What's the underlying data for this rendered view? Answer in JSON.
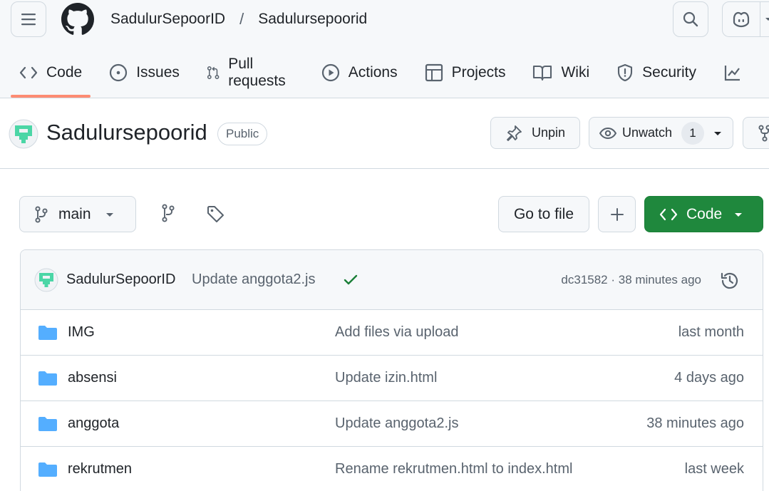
{
  "header": {
    "owner": "SadulurSepoorID",
    "separator": "/",
    "repo": "Sadulursepoorid"
  },
  "tabs": [
    {
      "label": "Code",
      "icon": "code-icon",
      "selected": true
    },
    {
      "label": "Issues",
      "icon": "issue-icon",
      "selected": false
    },
    {
      "label": "Pull requests",
      "icon": "pull-request-icon",
      "selected": false
    },
    {
      "label": "Actions",
      "icon": "play-icon",
      "selected": false
    },
    {
      "label": "Projects",
      "icon": "table-icon",
      "selected": false
    },
    {
      "label": "Wiki",
      "icon": "book-icon",
      "selected": false
    },
    {
      "label": "Security",
      "icon": "shield-icon",
      "selected": false
    }
  ],
  "repo": {
    "name": "Sadulursepoorid",
    "visibility": "Public",
    "unpin_label": "Unpin",
    "unwatch_label": "Unwatch",
    "watch_count": "1"
  },
  "file_nav": {
    "branch": "main",
    "go_to_file": "Go to file",
    "code_label": "Code"
  },
  "commit": {
    "author": "SadulurSepoorID",
    "message": "Update anggota2.js",
    "status": "success",
    "meta": "dc31582 · 38 minutes ago"
  },
  "files": [
    {
      "name": "IMG",
      "message": "Add files via upload",
      "date": "last month"
    },
    {
      "name": "absensi",
      "message": "Update izin.html",
      "date": "4 days ago"
    },
    {
      "name": "anggota",
      "message": "Update anggota2.js",
      "date": "38 minutes ago"
    },
    {
      "name": "rekrutmen",
      "message": "Rename rekrutmen.html to index.html",
      "date": "last week"
    }
  ],
  "colors": {
    "accent_underline": "#fd8c73",
    "primary_button": "#1f883d",
    "folder": "#54aeff",
    "check": "#1a7f37"
  }
}
